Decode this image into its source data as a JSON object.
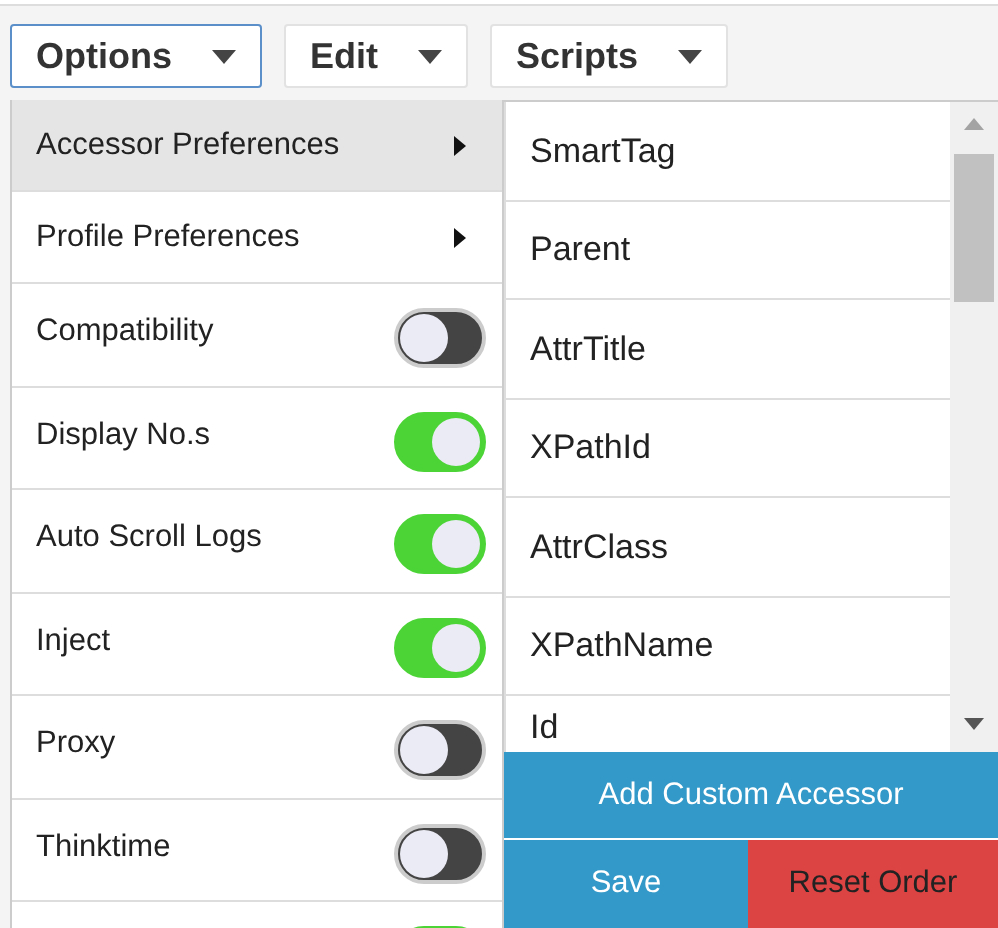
{
  "menubar": [
    {
      "label": "Options",
      "selected": true
    },
    {
      "label": "Edit",
      "selected": false
    },
    {
      "label": "Scripts",
      "selected": false
    }
  ],
  "options_menu": [
    {
      "kind": "submenu",
      "label": "Accessor Preferences",
      "selected": true
    },
    {
      "kind": "submenu",
      "label": "Profile Preferences",
      "selected": false
    },
    {
      "kind": "toggle",
      "label": "Compatibility",
      "on": false
    },
    {
      "kind": "toggle",
      "label": "Display No.s",
      "on": true
    },
    {
      "kind": "toggle",
      "label": "Auto Scroll Logs",
      "on": true
    },
    {
      "kind": "toggle",
      "label": "Inject",
      "on": true
    },
    {
      "kind": "toggle",
      "label": "Proxy",
      "on": false
    },
    {
      "kind": "toggle",
      "label": "Thinktime",
      "on": false
    },
    {
      "kind": "toggle",
      "on": true
    }
  ],
  "accessors": [
    "SmartTag",
    "Parent",
    "AttrTitle",
    "XPathId",
    "AttrClass",
    "XPathName",
    "Id"
  ],
  "accessor_buttons": {
    "add": "Add Custom Accessor",
    "save": "Save",
    "reset": "Reset Order"
  }
}
